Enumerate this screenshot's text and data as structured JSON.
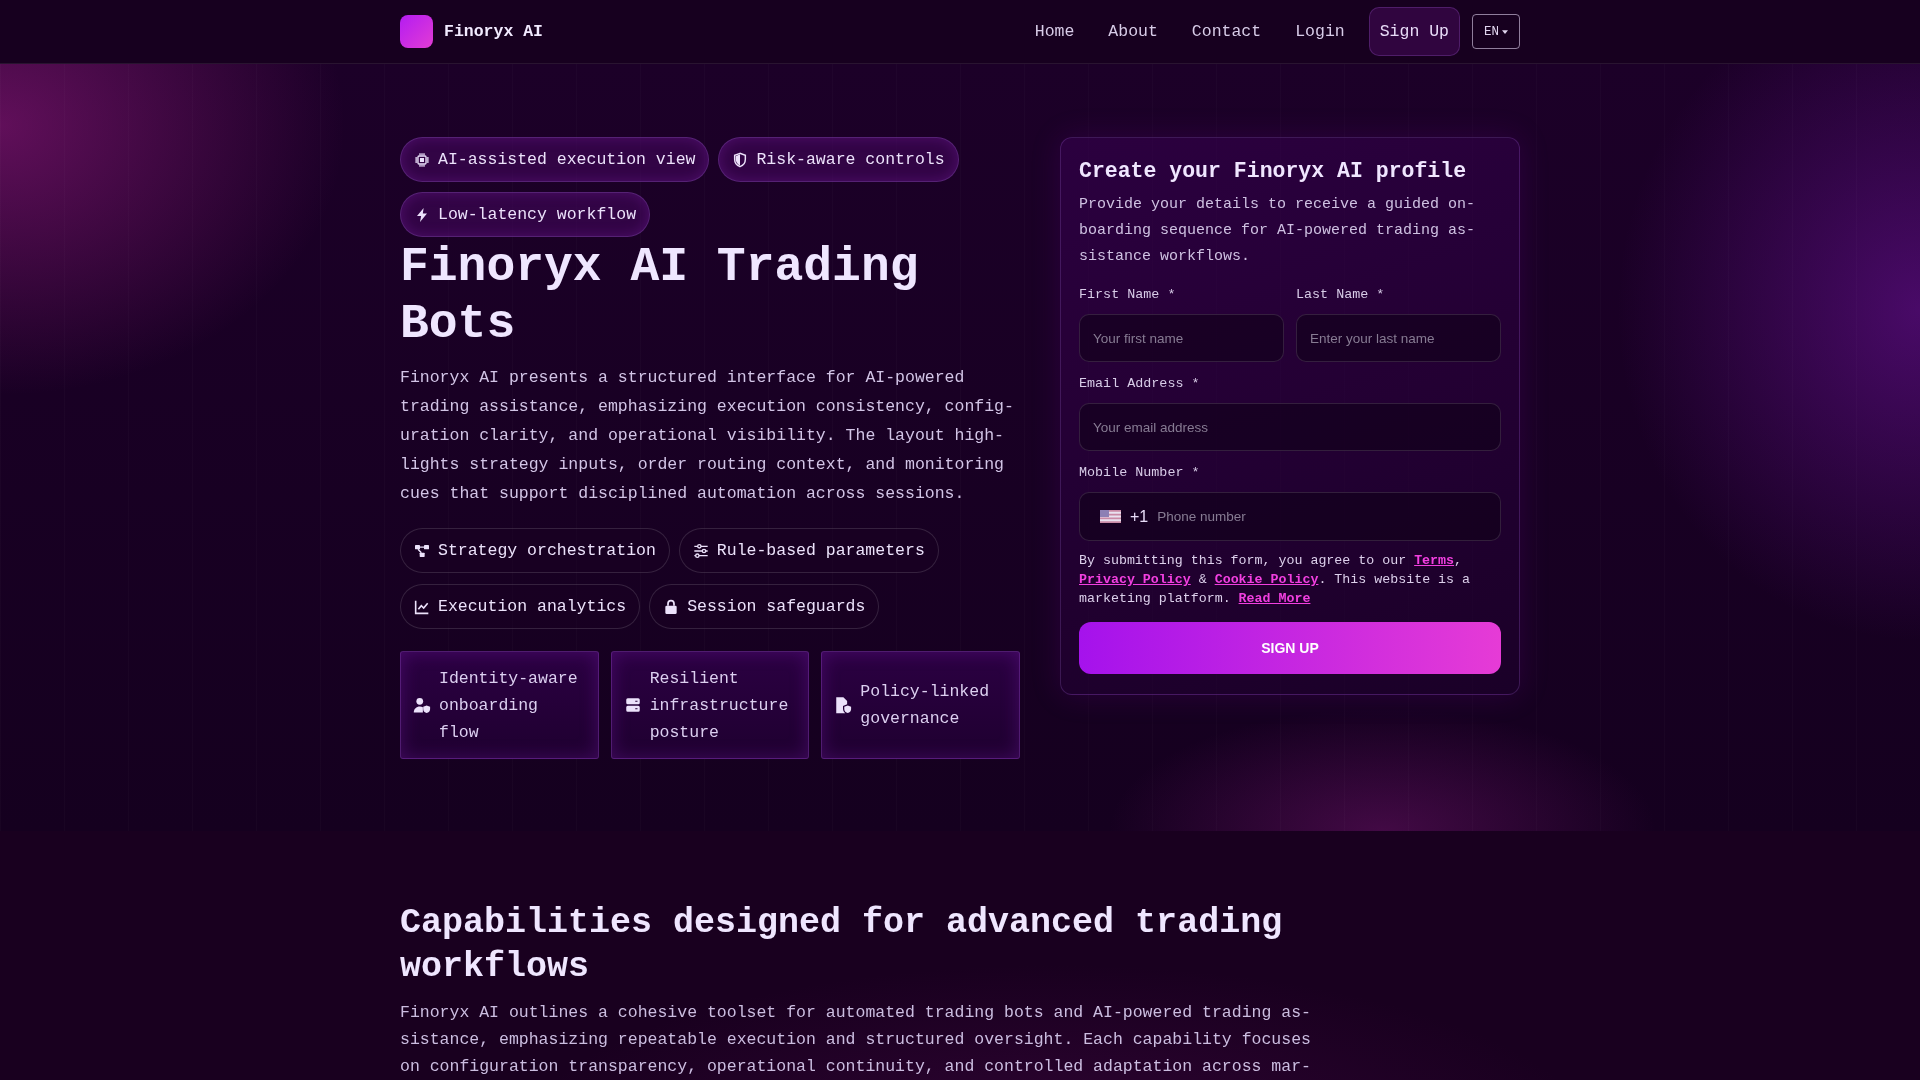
{
  "header": {
    "brand": "Finoryx AI",
    "nav": [
      "Home",
      "About",
      "Contact",
      "Login"
    ],
    "signup": "Sign Up",
    "language": "EN"
  },
  "hero": {
    "badges": [
      "AI-assisted execution view",
      "Risk-aware controls",
      "Low-latency workflow"
    ],
    "title": "Finoryx AI Trading Bots",
    "intro_lines": [
      "Finoryx AI presents a structured interface for AI-powered",
      "trading assistance, emphasizing execution consistency, config-",
      "uration clarity, and operational visibility. The layout high-",
      "lights strategy inputs, order routing context, and monitoring",
      "cues that support disciplined automation across sessions."
    ],
    "tags": [
      "Strategy orchestration",
      "Rule-based parameters",
      "Execution analytics",
      "Session safeguards"
    ],
    "cards": [
      "Identity-aware onboarding flow",
      "Resilient infrastructure posture",
      "Policy-linked governance"
    ]
  },
  "signup_form": {
    "title": "Create your Finoryx AI profile",
    "description_lines": [
      "Provide your details to receive a guided on-",
      "boarding sequence for AI-powered trading as-",
      "sistance workflows."
    ],
    "fields": [
      {
        "kind": "text",
        "label": "First Name *",
        "placeholder": "Your first name"
      },
      {
        "kind": "text",
        "label": "Last Name *",
        "placeholder": "Enter your last name"
      },
      {
        "kind": "text",
        "label": "Email Address *",
        "placeholder": "Your email address"
      },
      {
        "kind": "phone",
        "label": "Mobile Number *",
        "dial_code": "+1",
        "placeholder": "Phone number"
      }
    ],
    "consent": [
      {
        "kind": "text",
        "text": "By submitting this form, you agree to our "
      },
      {
        "kind": "link",
        "text": "Terms"
      },
      {
        "kind": "text",
        "text": ", "
      },
      {
        "kind": "link",
        "text": "Privacy Policy"
      },
      {
        "kind": "text",
        "text": " & "
      },
      {
        "kind": "link",
        "text": "Cookie Policy"
      },
      {
        "kind": "text",
        "text": ". This website is a marketing platform. "
      },
      {
        "kind": "link",
        "text": "Read More"
      }
    ],
    "submit": "SIGN UP"
  },
  "capabilities": {
    "title": "Capabilities designed for advanced trading workflows",
    "intro_lines": [
      "Finoryx AI outlines a cohesive toolset for automated trading bots and AI-powered trading as-",
      "sistance, emphasizing repeatable execution and structured oversight. Each capability focuses",
      "on configuration transparency, operational continuity, and controlled adaptation across mar-"
    ]
  }
}
